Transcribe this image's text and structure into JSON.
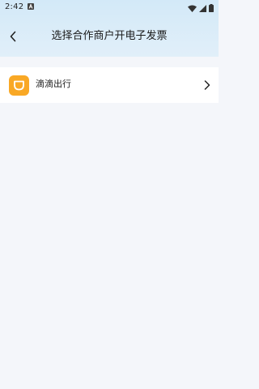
{
  "status_bar": {
    "time": "2:42",
    "notification_icon": "a-badge-icon",
    "icons": [
      "wifi-icon",
      "signal-icon",
      "battery-icon"
    ]
  },
  "header": {
    "title": "选择合作商户开电子发票",
    "back_icon": "back-arrow-icon"
  },
  "merchants": [
    {
      "name": "滴滴出行",
      "logo": "didi-logo",
      "logo_color": "#f9a825",
      "chevron_icon": "chevron-right-icon"
    }
  ],
  "colors": {
    "header_bg": "#d3e9f8",
    "page_bg": "#f4f6fa",
    "row_bg": "#ffffff"
  }
}
